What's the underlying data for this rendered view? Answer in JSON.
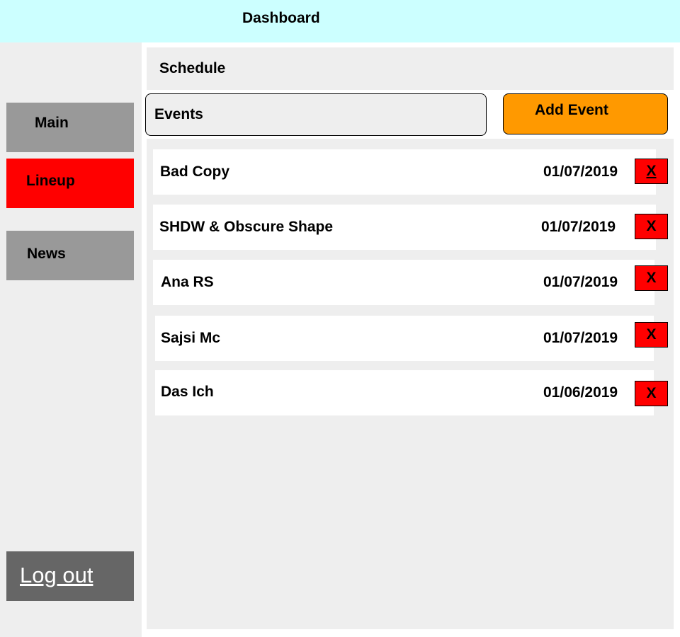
{
  "header": {
    "title": "Dashboard"
  },
  "sidebar": {
    "items": [
      {
        "label": "Main",
        "active": false
      },
      {
        "label": "Lineup",
        "active": true
      },
      {
        "label": "News",
        "active": false
      }
    ],
    "logout_label": "Log out"
  },
  "main": {
    "section_title": "Schedule",
    "events_label": "Events",
    "add_event_label": "Add Event",
    "events": [
      {
        "name": "Bad Copy",
        "date": "01/07/2019",
        "delete_label": "X"
      },
      {
        "name": "SHDW & Obscure Shape",
        "date": "01/07/2019",
        "delete_label": "X"
      },
      {
        "name": "Ana RS",
        "date": "01/07/2019",
        "delete_label": "X"
      },
      {
        "name": "Sajsi Mc",
        "date": "01/07/2019",
        "delete_label": "X"
      },
      {
        "name": "Das Ich",
        "date": "01/06/2019",
        "delete_label": "X"
      }
    ]
  },
  "colors": {
    "header_bg": "#ccffff",
    "sidebar_bg": "#eeeeee",
    "nav_inactive": "#999999",
    "nav_active": "#ff0000",
    "logout_bg": "#666666",
    "accent": "#ff9900",
    "delete": "#ff0000"
  }
}
